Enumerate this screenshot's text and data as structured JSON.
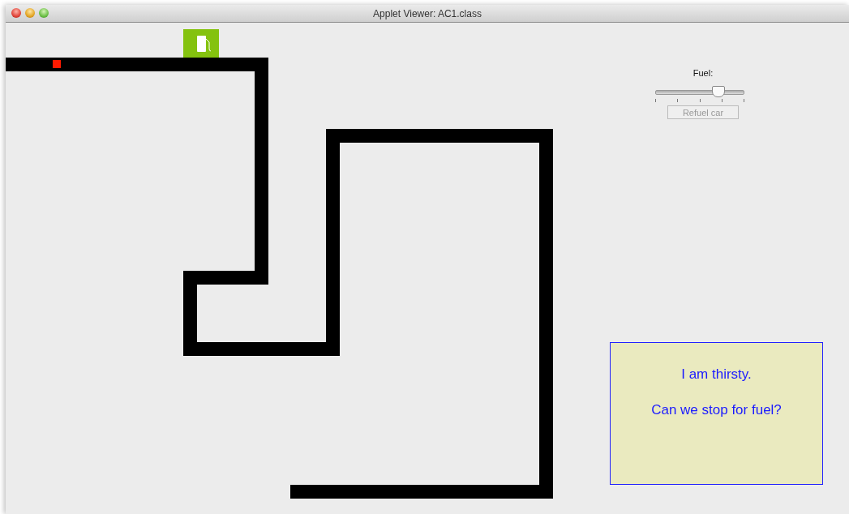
{
  "window": {
    "title": "Applet Viewer: AC1.class"
  },
  "controls": {
    "fuel_label": "Fuel:",
    "fuel_slider": {
      "level": 0.7
    },
    "refuel_button": {
      "label": "Refuel car",
      "disabled": true
    }
  },
  "message": {
    "lines": [
      "I am thirsty.",
      "Can we stop for fuel?"
    ]
  }
}
